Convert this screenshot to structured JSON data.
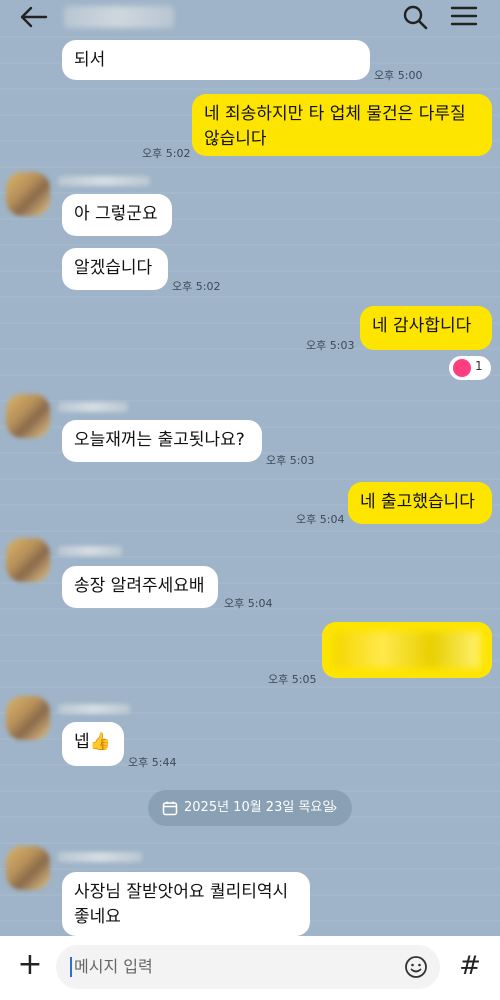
{
  "header": {
    "back_icon": "arrow-left-icon",
    "search_icon": "search-icon",
    "menu_icon": "hamburger-menu-icon"
  },
  "messages": [
    {
      "text": "되서",
      "time": "오후 5:00"
    },
    {
      "line1": "네 죄송하지만 타 업체 물건은 다루질",
      "line2": "않습니다",
      "time": "오후 5:02"
    },
    {
      "text": "아 그렇군요"
    },
    {
      "text": "알겠습니다",
      "time": "오후 5:02"
    },
    {
      "text": "네 감사합니다",
      "time": "오후 5:03",
      "reaction_count": "1"
    },
    {
      "text": "오늘재꺼는 출고됫나요?",
      "time": "오후 5:03"
    },
    {
      "text": "네 출고했습니다",
      "time": "오후 5:04"
    },
    {
      "text": "송장 알려주세요배",
      "time": "오후 5:04"
    },
    {
      "text": "",
      "time": "오후 5:05"
    },
    {
      "text": "넵👍",
      "time": "오후 5:44"
    },
    {
      "line1": "사장님 잘받앗어요 퀄리티역시",
      "line2": "좋네요"
    }
  ],
  "date_divider": {
    "text": "2025년 10월 23일 목요일",
    "chevron": "›"
  },
  "footer": {
    "plus_label": "+",
    "input_placeholder": "메시지 입력",
    "emoji_icon": "emoji-icon",
    "hash_label": "#"
  },
  "colors": {
    "background": "#9fb4c8",
    "outgoing_bubble": "#fee500",
    "incoming_bubble": "#ffffff",
    "reaction_heart": "#ff3d7f"
  }
}
